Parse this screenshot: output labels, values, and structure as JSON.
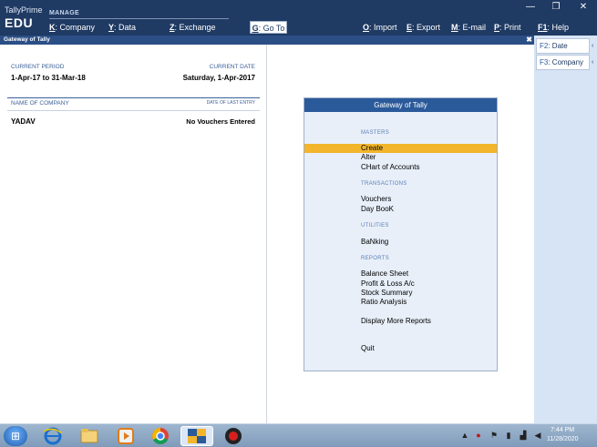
{
  "brand": {
    "product": "TallyPrime",
    "edition": "EDU",
    "section": "MANAGE"
  },
  "menu": {
    "company": {
      "key": "K",
      "label": ": Company"
    },
    "data": {
      "key": "Y",
      "label": ": Data"
    },
    "exchange": {
      "key": "Z",
      "label": ": Exchange"
    },
    "goto": {
      "key": "G",
      "label": ": Go To"
    },
    "import": {
      "key": "O",
      "label": ": Import"
    },
    "export": {
      "key": "E",
      "label": ": Export"
    },
    "email": {
      "key": "M",
      "label": ": E-mail"
    },
    "print": {
      "key": "P",
      "label": ": Print"
    },
    "help": {
      "key": "F1",
      "label": ": Help"
    }
  },
  "window_controls": {
    "minimize": "—",
    "restore": "❐",
    "close": "✕"
  },
  "gateway_strip": {
    "title": "Gateway of Tally",
    "close": "✖"
  },
  "info": {
    "current_period_label": "CURRENT PERIOD",
    "current_period_value": "1-Apr-17 to 31-Mar-18",
    "current_date_label": "CURRENT DATE",
    "current_date_value": "Saturday, 1-Apr-2017",
    "company_label": "NAME OF COMPANY",
    "last_entry_label": "DATE OF LAST ENTRY",
    "company_name": "YADAV",
    "last_entry_value": "No Vouchers Entered"
  },
  "gateway": {
    "title": "Gateway of Tally",
    "sections": {
      "masters": "MASTERS",
      "transactions": "TRANSACTIONS",
      "utilities": "UTILITIES",
      "reports": "REPORTS"
    },
    "items": {
      "create": "Create",
      "alter": "Alter",
      "chart_of_accounts": "CHart of Accounts",
      "vouchers": "Vouchers",
      "day_book": "Day BooK",
      "banking": "BaNking",
      "balance_sheet": "Balance Sheet",
      "profit_loss": "Profit & Loss A/c",
      "stock_summary": "Stock Summary",
      "ratio_analysis": "Ratio Analysis",
      "display_more_reports": "Display More Reports",
      "quit": "Quit"
    },
    "selected": "create"
  },
  "buttons": {
    "f2": {
      "key": "F2",
      "label": ": Date"
    },
    "f3": {
      "key": "F3",
      "label": ": Company"
    },
    "arrow": "‹"
  },
  "taskbar": {
    "time": "7:44 PM",
    "date": "11/28/2020",
    "colors": {
      "bar": "#8aa5c4",
      "tally_active": "#f3b52b"
    }
  },
  "colors": {
    "title_bar": "#1f3a63",
    "accent": "#2b5a9a",
    "selection": "#f3b52b",
    "menu_box": "#e8eff9",
    "button_bar": "#d6e4f5"
  }
}
